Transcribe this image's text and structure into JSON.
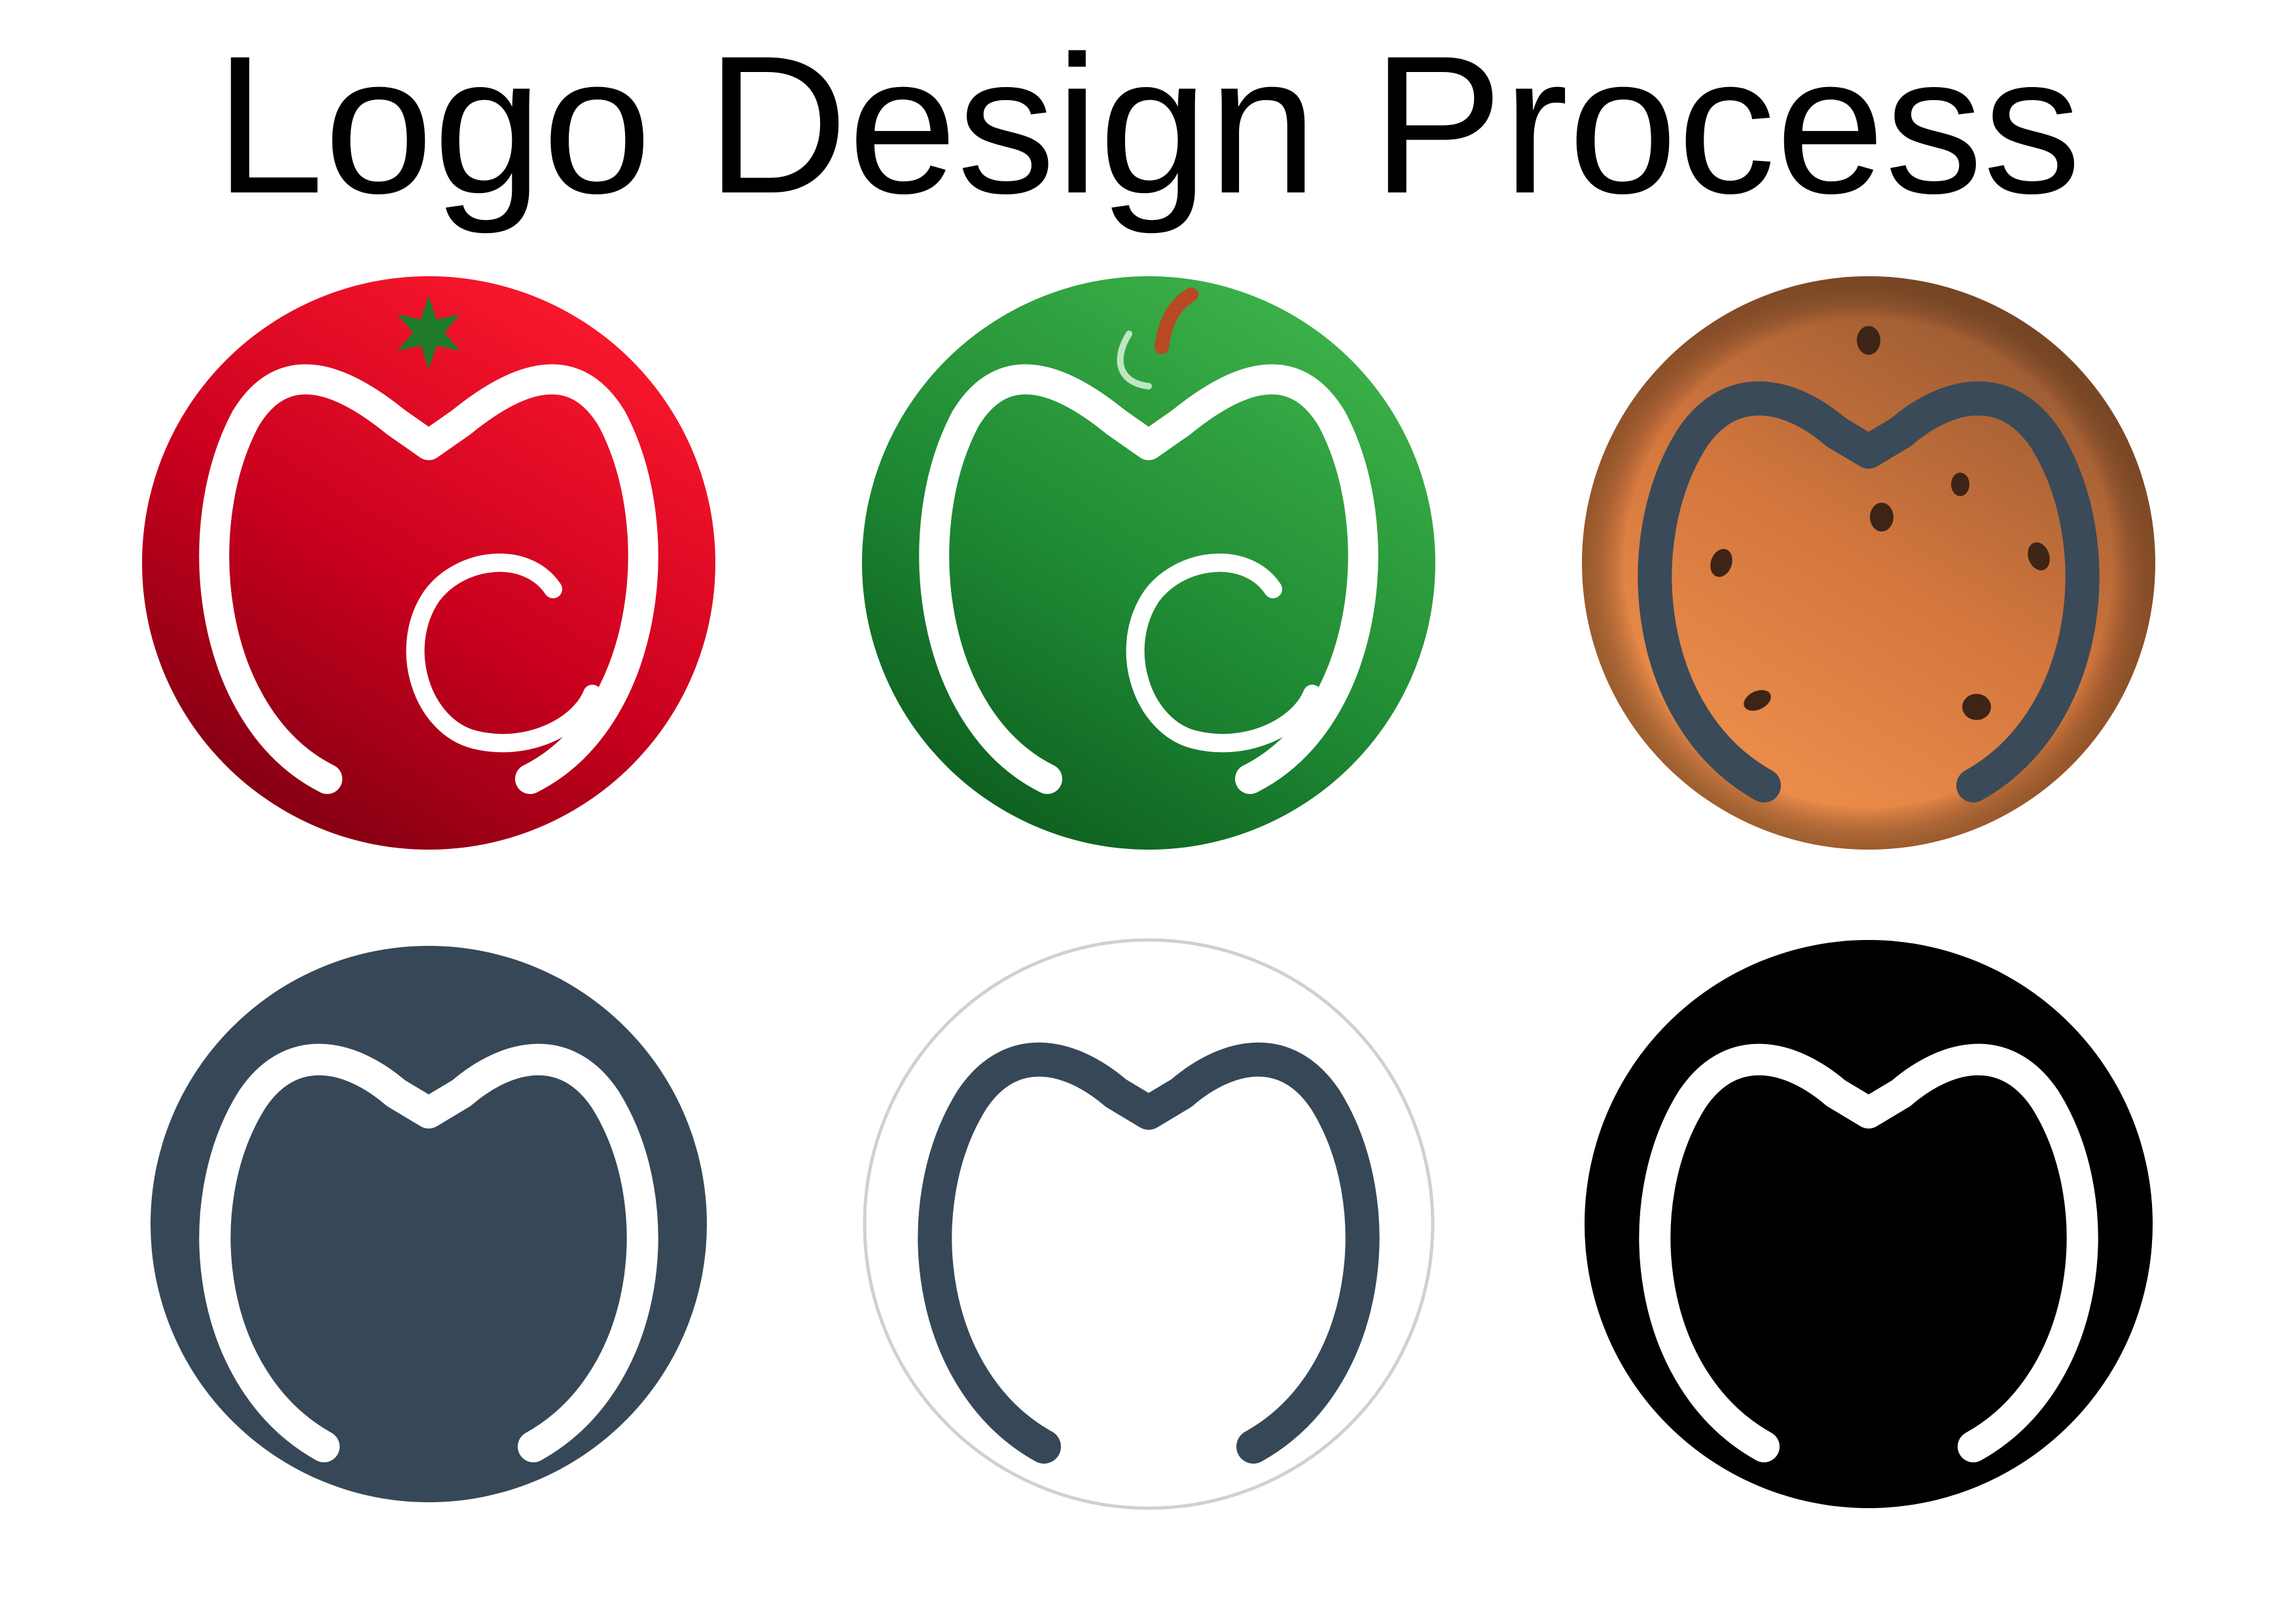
{
  "page": {
    "title": "Logo Design Process"
  },
  "logos": [
    {
      "name": "tomato-logo",
      "fill": "#c4001c",
      "mark": "#ffffff",
      "accent": "#1f7a2c"
    },
    {
      "name": "apple-logo",
      "fill": "#1d8a35",
      "mark": "#ffffff",
      "accent": "#b74a22"
    },
    {
      "name": "cookie-logo",
      "fill": "#d9834a",
      "mark": "#3a4a58",
      "accent": "#3d2416"
    },
    {
      "name": "slate-logo",
      "fill": "#364857",
      "mark": "#ffffff"
    },
    {
      "name": "outline-logo",
      "fill": "#ffffff",
      "mark": "#364857"
    },
    {
      "name": "black-logo",
      "fill": "#000000",
      "mark": "#ffffff"
    }
  ]
}
